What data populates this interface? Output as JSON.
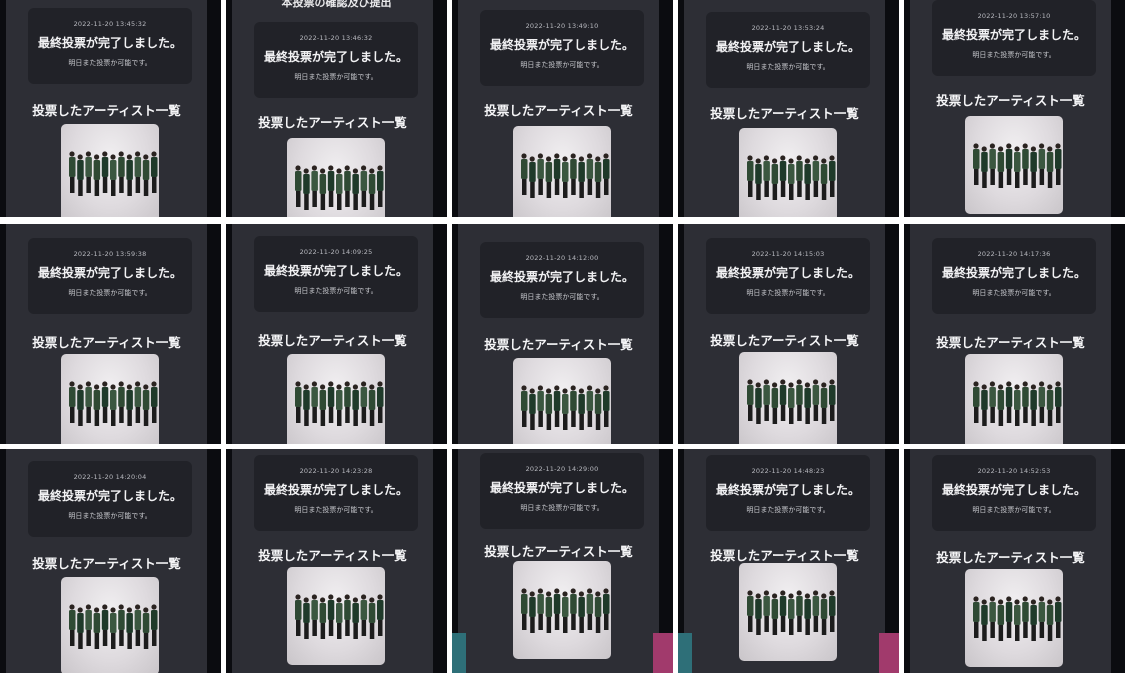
{
  "tiles": [
    {
      "timestamp": "2022-11-20 13:45:32"
    },
    {
      "timestamp": "2022-11-20 13:46:32",
      "peek": "本投票の確認及び提出"
    },
    {
      "timestamp": "2022-11-20 13:49:10"
    },
    {
      "timestamp": "2022-11-20 13:53:24"
    },
    {
      "timestamp": "2022-11-20 13:57:10"
    },
    {
      "timestamp": "2022-11-20 13:59:38"
    },
    {
      "timestamp": "2022-11-20 14:09:25"
    },
    {
      "timestamp": "2022-11-20 14:12:00"
    },
    {
      "timestamp": "2022-11-20 14:15:03"
    },
    {
      "timestamp": "2022-11-20 14:17:36"
    },
    {
      "timestamp": "2022-11-20 14:20:04"
    },
    {
      "timestamp": "2022-11-20 14:23:28"
    },
    {
      "timestamp": "2022-11-20 14:29:00"
    },
    {
      "timestamp": "2022-11-20 14:48:23"
    },
    {
      "timestamp": "2022-11-20 14:52:53"
    }
  ],
  "common": {
    "completed_message": "最終投票が完了しました。",
    "again_message": "明日また投票か可能です。",
    "voted_list_title": "投票したアーティスト一覧"
  },
  "colors": {
    "page_bg": "#0b0c10",
    "panel_bg": "#2d2e35",
    "card_bg": "#212228",
    "text_primary": "#f2f2f4",
    "accent_teal": "#2e6f78",
    "accent_pink": "#a13a6c"
  }
}
